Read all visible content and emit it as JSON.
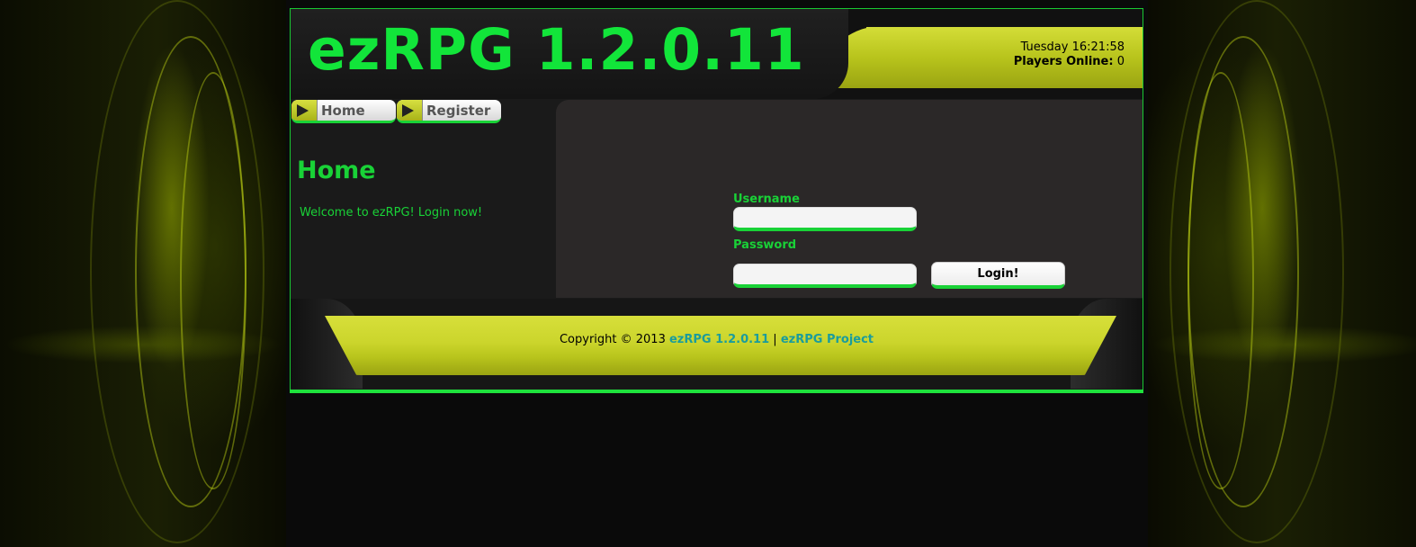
{
  "header": {
    "logo": "ezRPG 1.2.0.11",
    "datetime": "Tuesday 16:21:58",
    "players_label": "Players Online:",
    "players_count": "0"
  },
  "nav": {
    "home": "Home",
    "register": "Register"
  },
  "main": {
    "title": "Home",
    "welcome": "Welcome to ezRPG! Login now!"
  },
  "login": {
    "username_label": "Username",
    "username_value": "",
    "password_label": "Password",
    "password_value": "",
    "submit": "Login!"
  },
  "footer": {
    "copyright": "Copyright © 2013",
    "link1": "ezRPG 1.2.0.11",
    "separator": "|",
    "link2": "ezRPG Project"
  },
  "colors": {
    "accent_green": "#19d237",
    "lime": "#d4dd38",
    "link": "#1a9c9c"
  },
  "icons": {
    "nav_arrow": "play-arrow-icon"
  }
}
